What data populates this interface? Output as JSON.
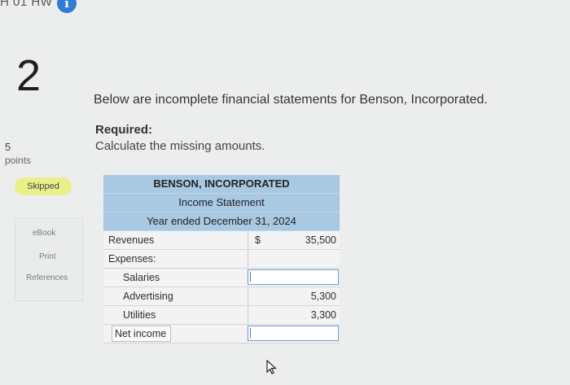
{
  "header": {
    "assignment_title": "H 01 HW",
    "info_icon_glyph": "i"
  },
  "question": {
    "number": "2",
    "points_value": "5",
    "points_label": "points",
    "status_badge": "Skipped"
  },
  "sidebar": {
    "ebook_label": "eBook",
    "print_label": "Print",
    "references_label": "References"
  },
  "prompt": {
    "text": "Below are incomplete financial statements for Benson, Incorporated.",
    "required_title": "Required:",
    "required_text": "Calculate the missing amounts."
  },
  "statement": {
    "company": "BENSON, INCORPORATED",
    "title": "Income Statement",
    "period": "Year ended December 31, 2024",
    "rows": {
      "revenues": {
        "label": "Revenues",
        "currency": "$",
        "value": "35,500"
      },
      "expenses": {
        "label": "Expenses:"
      },
      "salaries": {
        "label": "Salaries",
        "value": ""
      },
      "advertising": {
        "label": "Advertising",
        "value": "5,300"
      },
      "utilities": {
        "label": "Utilities",
        "value": "3,300"
      },
      "net_income": {
        "label": "Net income",
        "value": ""
      }
    }
  },
  "colors": {
    "header_fill": "#a9c8e2",
    "badge_skipped": "#e9f08a",
    "info_badge": "#2f7bd6",
    "input_border": "#6a9bd0"
  }
}
